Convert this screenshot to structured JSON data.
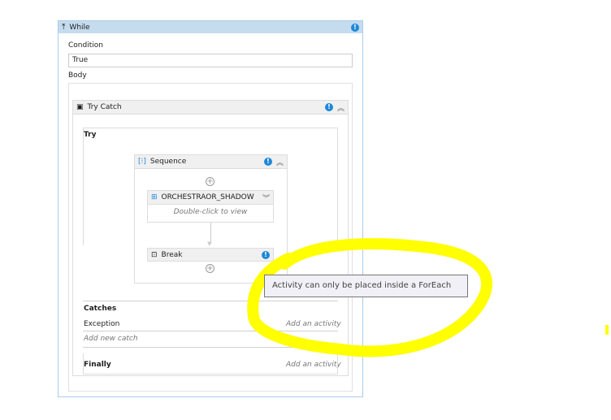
{
  "while": {
    "title": "While",
    "condition_label": "Condition",
    "condition_value": "True",
    "body_label": "Body"
  },
  "try_catch": {
    "title": "Try Catch",
    "try_label": "Try",
    "catches_label": "Catches",
    "exception_label": "Exception",
    "add_activity": "Add an activity",
    "add_new_catch": "Add new catch",
    "finally_label": "Finally",
    "finally_add": "Add an activity"
  },
  "sequence": {
    "title": "Sequence"
  },
  "invoke": {
    "title": "ORCHESTRAOR_SHADOW",
    "hint": "Double-click to view"
  },
  "break": {
    "title": "Break"
  },
  "tooltip": "Activity can only be placed inside a ForEach",
  "colors": {
    "header_blue": "#c5dcef",
    "info": "#1e88d8",
    "highlight": "#ffff00"
  }
}
